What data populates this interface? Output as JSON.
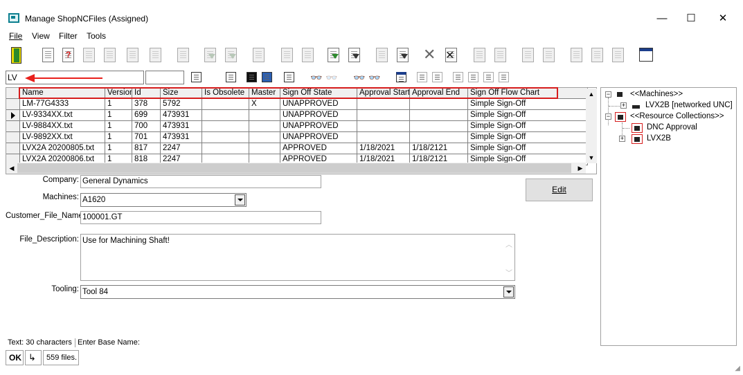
{
  "window": {
    "title": "Manage ShopNCFiles (Assigned)",
    "controls": {
      "minimize": "—",
      "maximize": "☐",
      "close": "✕"
    }
  },
  "menu": {
    "items": [
      "File",
      "View",
      "Filter",
      "Tools"
    ]
  },
  "filter": {
    "search_value": "LV"
  },
  "grid": {
    "columns": [
      "Name",
      "Version",
      "Id",
      "Size",
      "Is Obsolete",
      "Master",
      "Sign Off State",
      "Approval Start",
      "Approval End",
      "Sign Off Flow Chart"
    ],
    "rows": [
      [
        "LM-77G4333",
        "1",
        "378",
        "5792",
        "",
        "X",
        "UNAPPROVED",
        "",
        "",
        "Simple Sign-Off"
      ],
      [
        "LV-9334XX.txt",
        "1",
        "699",
        "473931",
        "",
        "",
        "UNAPPROVED",
        "",
        "",
        "Simple Sign-Off"
      ],
      [
        "LV-9884XX.txt",
        "1",
        "700",
        "473931",
        "",
        "",
        "UNAPPROVED",
        "",
        "",
        "Simple Sign-Off"
      ],
      [
        "LV-9892XX.txt",
        "1",
        "701",
        "473931",
        "",
        "",
        "UNAPPROVED",
        "",
        "",
        "Simple Sign-Off"
      ],
      [
        "LVX2A 20200805.txt",
        "1",
        "817",
        "2247",
        "",
        "",
        "APPROVED",
        "1/18/2021",
        "1/18/2121",
        "Simple Sign-Off"
      ],
      [
        "LVX2A 20200806.txt",
        "1",
        "818",
        "2247",
        "",
        "",
        "APPROVED",
        "1/18/2021",
        "1/18/2121",
        "Simple Sign-Off"
      ]
    ],
    "selected_row": 1
  },
  "details": {
    "company_label": "Company:",
    "company_value": "General Dynamics",
    "machines_label": "Machines:",
    "machines_value": "A1620",
    "customer_file_label": "Customer_File_Name:",
    "customer_file_value": "100001.GT",
    "file_desc_label": "File_Description:",
    "file_desc_value": "Use for Machining Shaft!",
    "tooling_label": "Tooling:",
    "tooling_value": "Tool 84",
    "edit_button": "Edit"
  },
  "status": {
    "text_info": "Text: 30 characters",
    "base_name": "Enter Base Name:",
    "ok": "OK",
    "arrow": "↳",
    "file_count": "559 files."
  },
  "tree": {
    "machines": "<<Machines>>",
    "machine_child": "LVX2B [networked UNC]",
    "collections": "<<Resource Collections>>",
    "coll_child_1": "DNC Approval",
    "coll_child_2": "LVX2B"
  },
  "colors": {
    "highlight_red": "#d61c1c",
    "arrow_red": "#e8201c"
  }
}
